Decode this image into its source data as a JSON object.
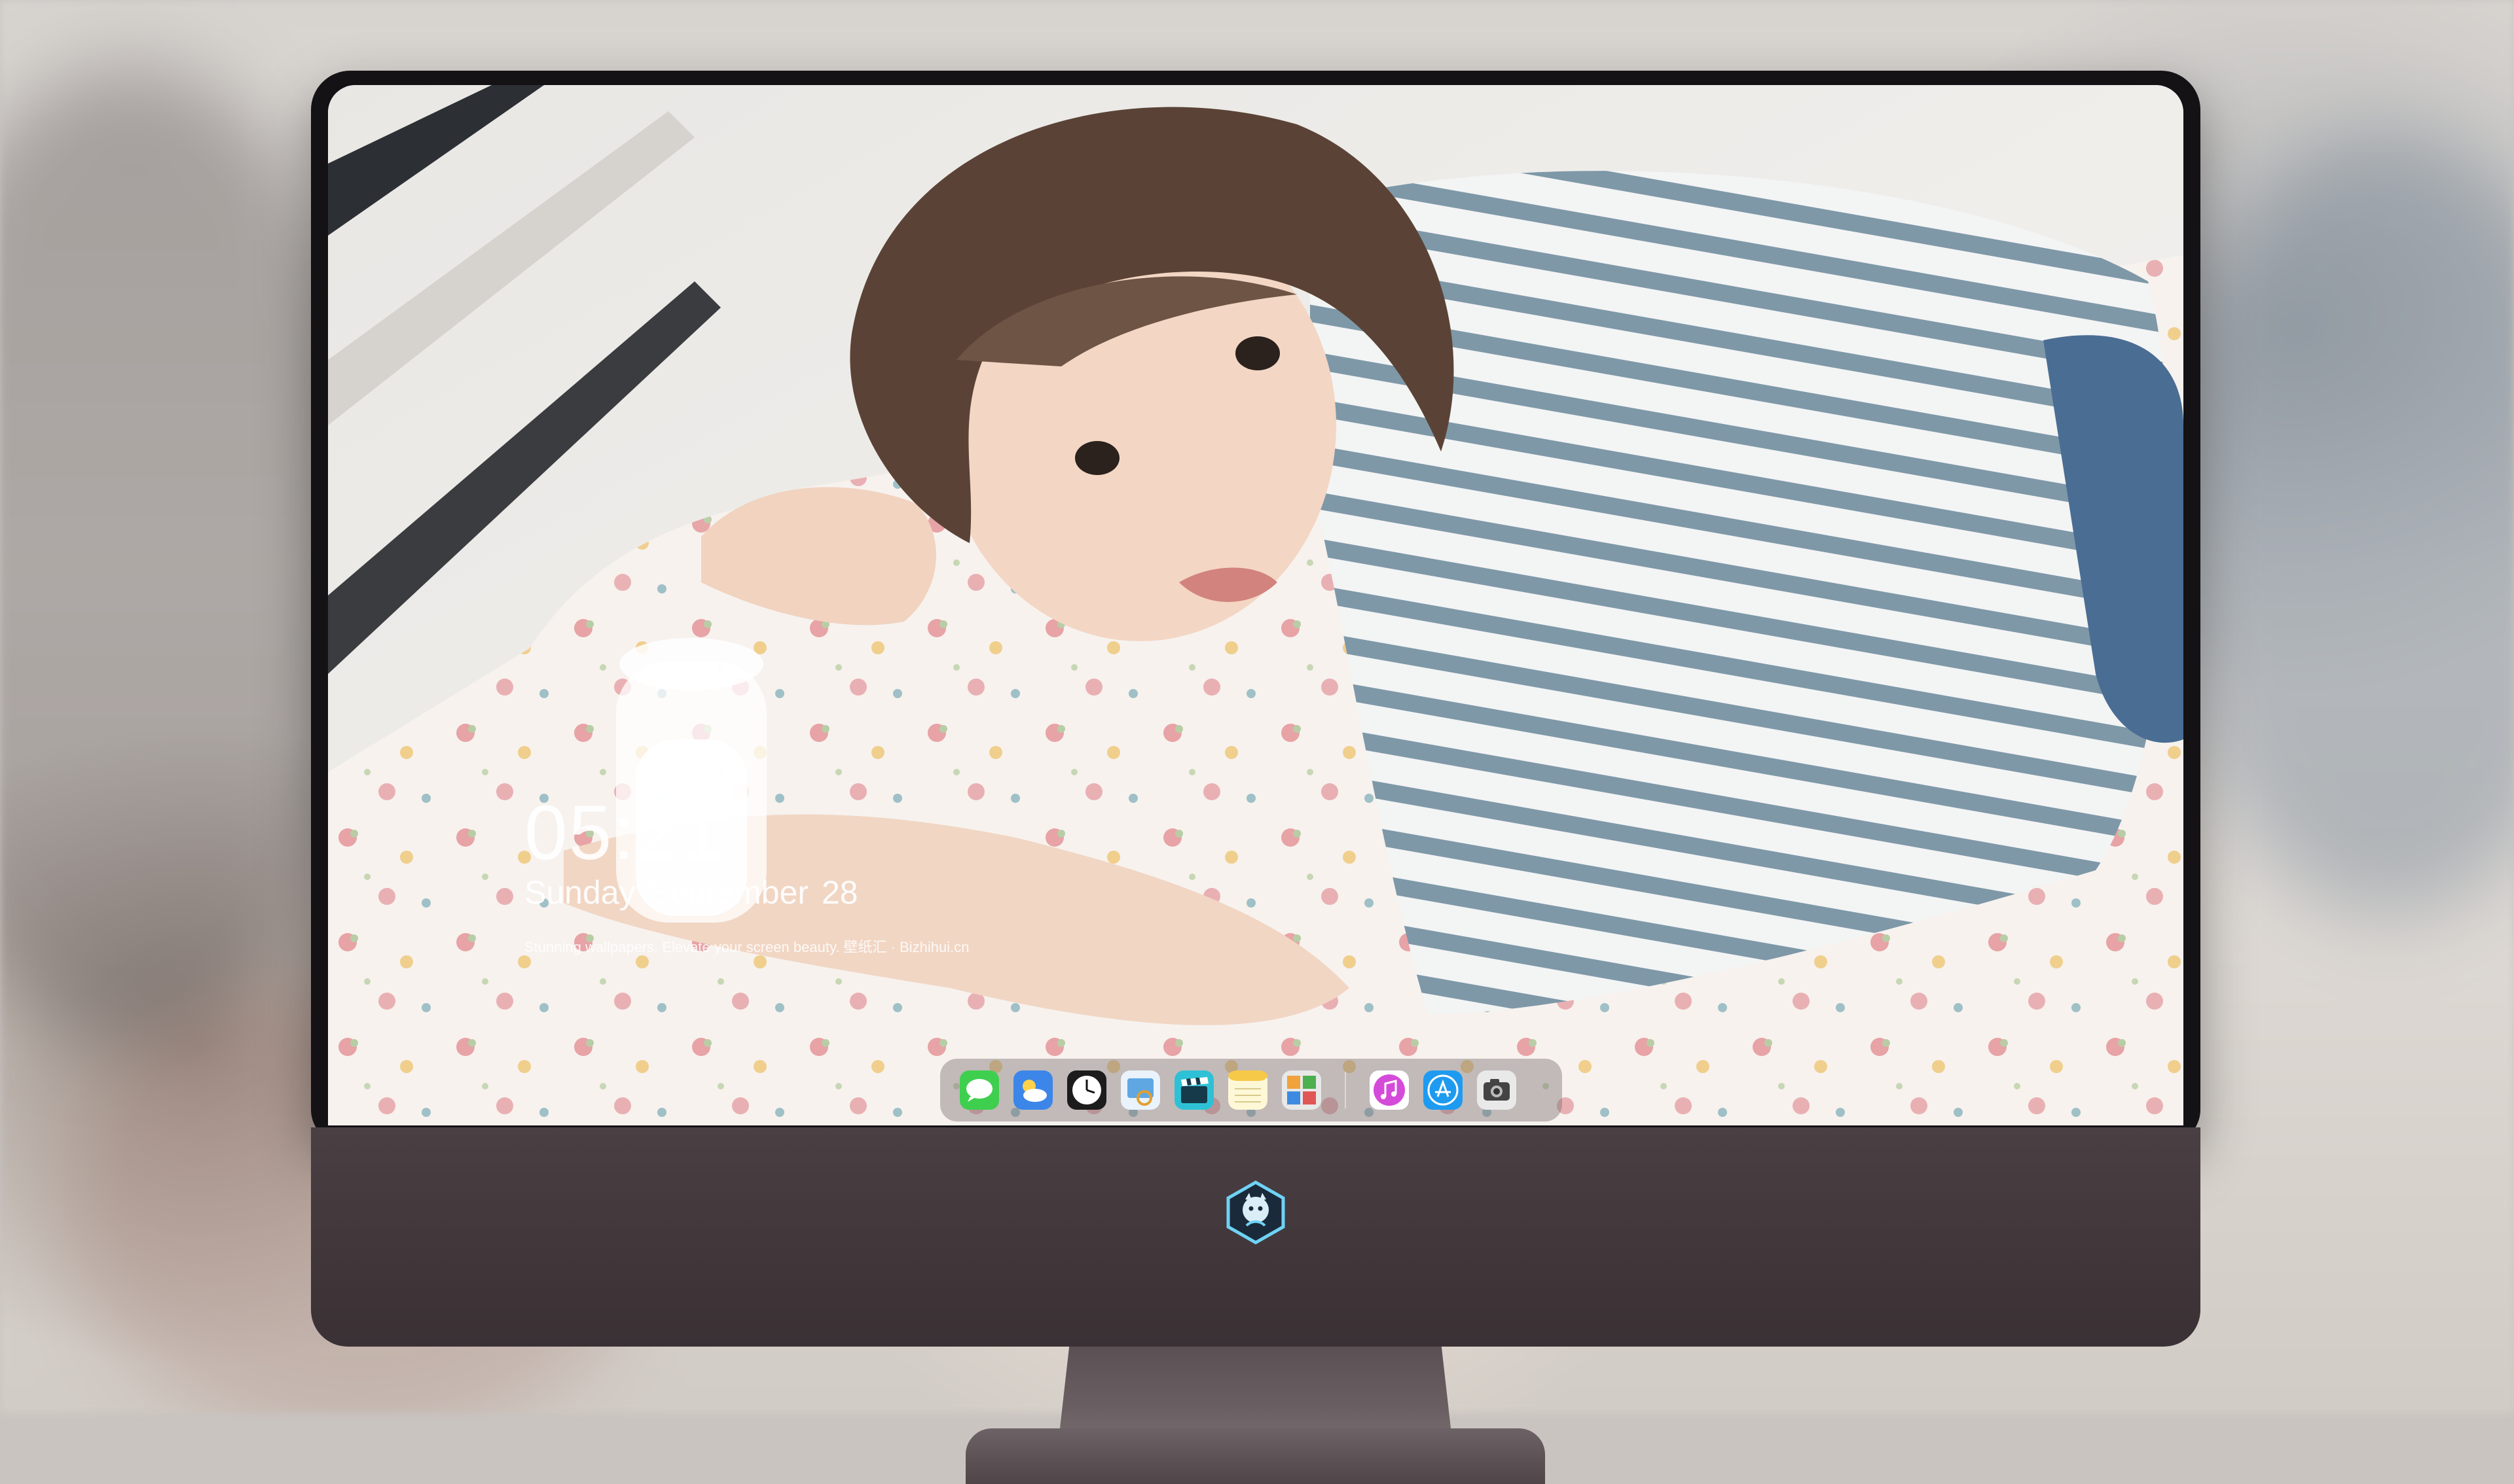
{
  "lockscreen": {
    "time": "05:21",
    "date": "Sunday September  28",
    "tagline": "Stunning wallpapers. Elevate your screen beauty. 壁纸汇 · Bizhihui.cn"
  },
  "dock": {
    "apps": [
      {
        "name": "Messages",
        "icon": "messages-icon"
      },
      {
        "name": "Weather",
        "icon": "weather-icon"
      },
      {
        "name": "Clock",
        "icon": "clock-icon"
      },
      {
        "name": "Preview",
        "icon": "preview-icon"
      },
      {
        "name": "Videos",
        "icon": "clapper-icon"
      },
      {
        "name": "Notes",
        "icon": "notes-icon"
      },
      {
        "name": "Photo Booth",
        "icon": "photo-booth-icon"
      },
      {
        "name": "iTunes",
        "icon": "music-icon"
      },
      {
        "name": "App Store",
        "icon": "app-store-icon"
      },
      {
        "name": "Camera",
        "icon": "camera-icon"
      }
    ]
  },
  "colors": {
    "bezel": "#141214",
    "chin": "#433a3e",
    "dock": "rgba(120,110,110,0.42)"
  }
}
